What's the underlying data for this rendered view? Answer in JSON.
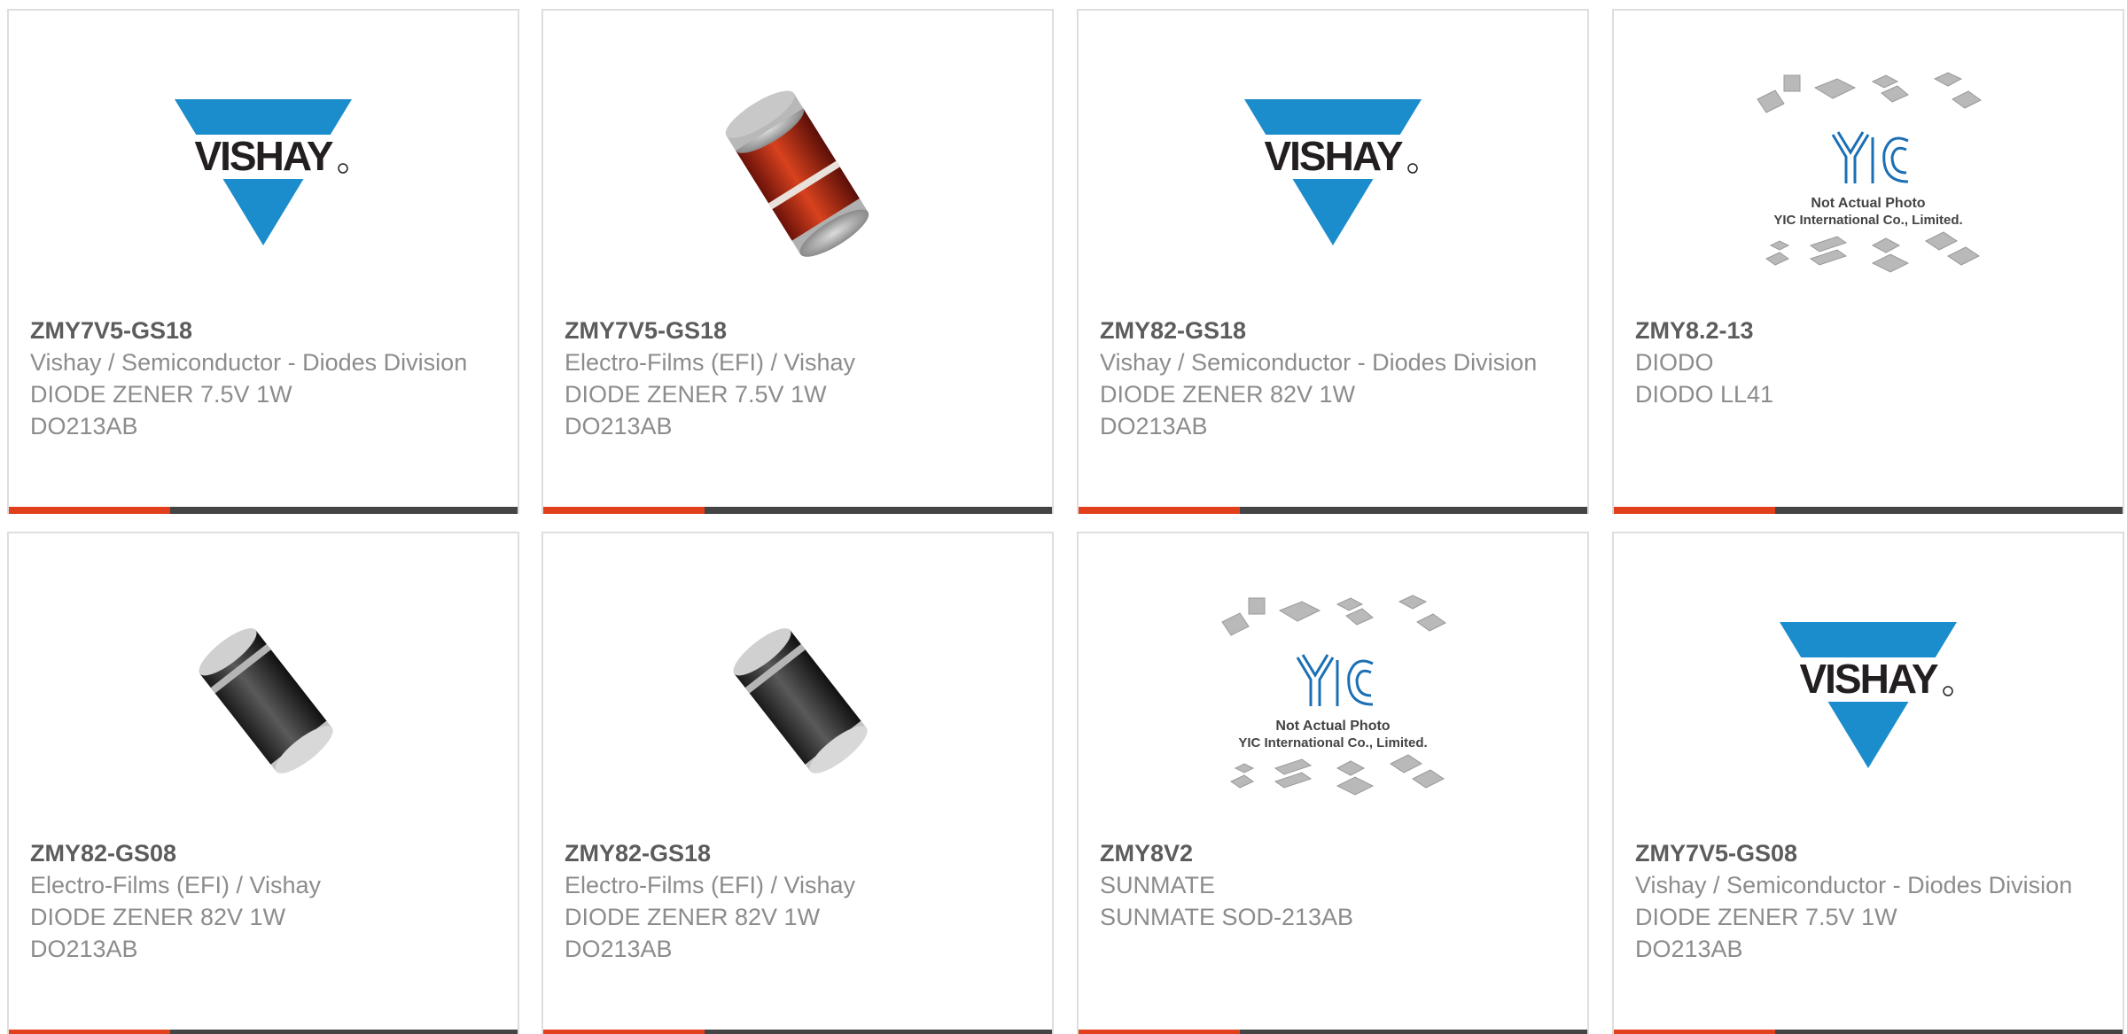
{
  "colors": {
    "accent": "#e2401c",
    "bar": "#444444",
    "border": "#dedede",
    "part_number": "#5c5c5c",
    "text": "#8c8c8c",
    "vishay_blue": "#1b8ccc"
  },
  "products": [
    {
      "part_number": "ZMY7V5-GS18",
      "manufacturer": "Vishay / Semiconductor - Diodes Division",
      "description": "DIODE ZENER 7.5V 1W",
      "package": "DO213AB",
      "image": "vishay-logo"
    },
    {
      "part_number": "ZMY7V5-GS18",
      "manufacturer": "Electro-Films (EFI) / Vishay",
      "description": "DIODE ZENER 7.5V 1W",
      "package": "DO213AB",
      "image": "red-melf-diode"
    },
    {
      "part_number": "ZMY82-GS18",
      "manufacturer": "Vishay / Semiconductor - Diodes Division",
      "description": "DIODE ZENER 82V 1W",
      "package": "DO213AB",
      "image": "vishay-logo"
    },
    {
      "part_number": "ZMY8.2-13",
      "manufacturer": "DIODO",
      "description": "DIODO LL41",
      "package": "",
      "image": "yic-placeholder",
      "image_text": [
        "Not Actual Photo",
        "YIC International Co., Limited."
      ]
    },
    {
      "part_number": "ZMY82-GS08",
      "manufacturer": "Electro-Films (EFI) / Vishay",
      "description": "DIODE ZENER 82V 1W",
      "package": "DO213AB",
      "image": "black-melf-diode"
    },
    {
      "part_number": "ZMY82-GS18",
      "manufacturer": "Electro-Films (EFI) / Vishay",
      "description": "DIODE ZENER 82V 1W",
      "package": "DO213AB",
      "image": "black-melf-diode"
    },
    {
      "part_number": "ZMY8V2",
      "manufacturer": "SUNMATE",
      "description": "SUNMATE SOD-213AB",
      "package": "",
      "image": "yic-placeholder",
      "image_text": [
        "Not Actual Photo",
        "YIC International Co., Limited."
      ]
    },
    {
      "part_number": "ZMY7V5-GS08",
      "manufacturer": "Vishay / Semiconductor - Diodes Division",
      "description": "DIODE ZENER 7.5V 1W",
      "package": "DO213AB",
      "image": "vishay-logo"
    }
  ]
}
